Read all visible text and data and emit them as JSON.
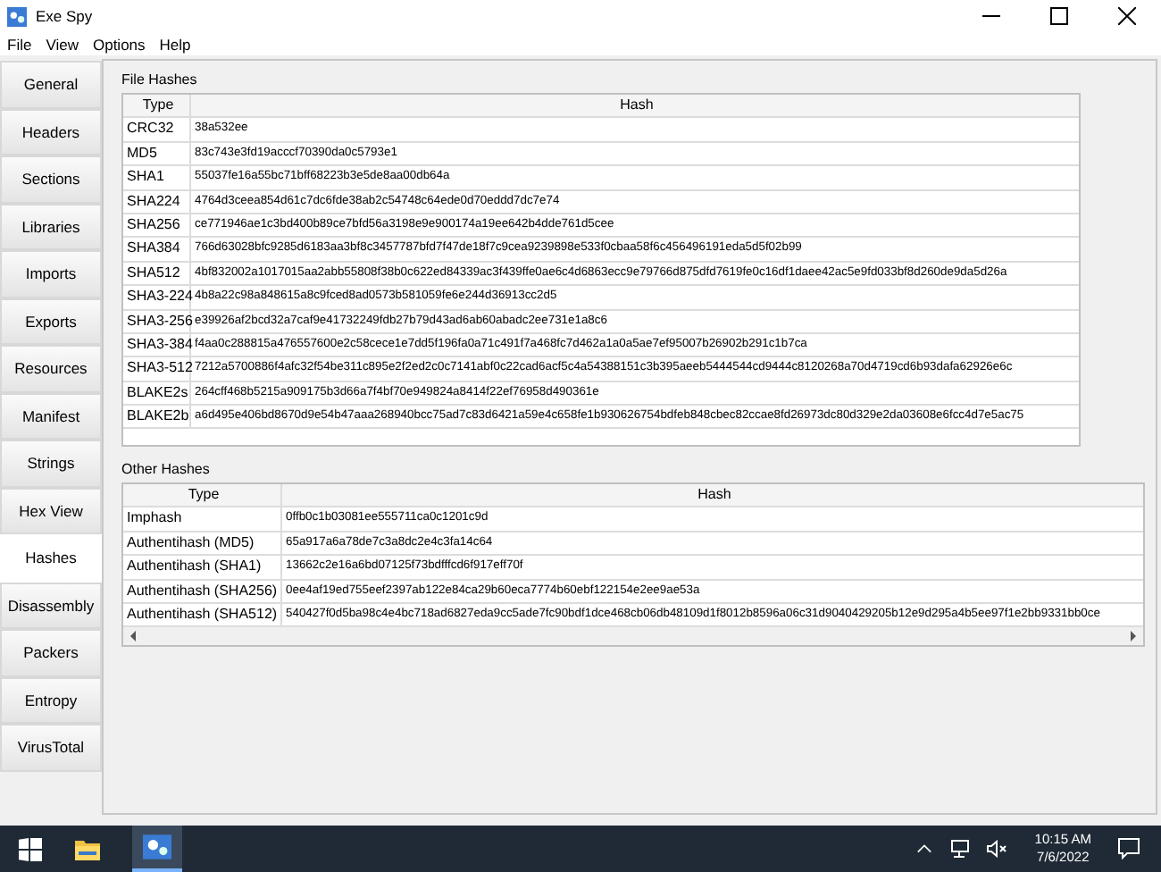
{
  "window": {
    "title": "Exe Spy"
  },
  "menu": [
    "File",
    "View",
    "Options",
    "Help"
  ],
  "sidebar": {
    "items": [
      {
        "label": "General",
        "selected": false
      },
      {
        "label": "Headers",
        "selected": false
      },
      {
        "label": "Sections",
        "selected": false
      },
      {
        "label": "Libraries",
        "selected": false
      },
      {
        "label": "Imports",
        "selected": false
      },
      {
        "label": "Exports",
        "selected": false
      },
      {
        "label": "Resources",
        "selected": false
      },
      {
        "label": "Manifest",
        "selected": false
      },
      {
        "label": "Strings",
        "selected": false
      },
      {
        "label": "Hex View",
        "selected": false
      },
      {
        "label": "Hashes",
        "selected": true
      },
      {
        "label": "Disassembly",
        "selected": false
      },
      {
        "label": "Packers",
        "selected": false
      },
      {
        "label": "Entropy",
        "selected": false
      },
      {
        "label": "VirusTotal",
        "selected": false
      }
    ]
  },
  "file_hashes": {
    "title": "File Hashes",
    "columns": [
      "Type",
      "Hash"
    ],
    "rows": [
      [
        "CRC32",
        "38a532ee"
      ],
      [
        "MD5",
        "83c743e3fd19acccf70390da0c5793e1"
      ],
      [
        "SHA1",
        "55037fe16a55bc71bff68223b3e5de8aa00db64a"
      ],
      [
        "SHA224",
        "4764d3ceea854d61c7dc6fde38ab2c54748c64ede0d70eddd7dc7e74"
      ],
      [
        "SHA256",
        "ce771946ae1c3bd400b89ce7bfd56a3198e9e900174a19ee642b4dde761d5cee"
      ],
      [
        "SHA384",
        "766d63028bfc9285d6183aa3bf8c3457787bfd7f47de18f7c9cea9239898e533f0cbaa58f6c456496191eda5d5f02b99"
      ],
      [
        "SHA512",
        "4bf832002a1017015aa2abb55808f38b0c622ed84339ac3f439ffe0ae6c4d6863ecc9e79766d875dfd7619fe0c16df1daee42ac5e9fd033bf8d260de9da5d26a"
      ],
      [
        "SHA3-224",
        "4b8a22c98a848615a8c9fced8ad0573b581059fe6e244d36913cc2d5"
      ],
      [
        "SHA3-256",
        "e39926af2bcd32a7caf9e41732249fdb27b79d43ad6ab60abadc2ee731e1a8c6"
      ],
      [
        "SHA3-384",
        "f4aa0c288815a476557600e2c58cece1e7dd5f196fa0a71c491f7a468fc7d462a1a0a5ae7ef95007b26902b291c1b7ca"
      ],
      [
        "SHA3-512",
        "7212a5700886f4afc32f54be311c895e2f2ed2c0c7141abf0c22cad6acf5c4a54388151c3b395aeeb5444544cd9444c8120268a70d4719cd6b93dafa62926e6c"
      ],
      [
        "BLAKE2s",
        "264cff468b5215a909175b3d66a7f4bf70e949824a8414f22ef76958d490361e"
      ],
      [
        "BLAKE2b",
        "a6d495e406bd8670d9e54b47aaa268940bcc75ad7c83d6421a59e4c658fe1b930626754bdfeb848cbec82ccae8fd26973dc80d329e2da03608e6fcc4d7e5ac75"
      ]
    ]
  },
  "other_hashes": {
    "title": "Other Hashes",
    "columns": [
      "Type",
      "Hash"
    ],
    "rows": [
      [
        "Imphash",
        "0ffb0c1b03081ee555711ca0c1201c9d"
      ],
      [
        "Authentihash (MD5)",
        "65a917a6a78de7c3a8dc2e4c3fa14c64"
      ],
      [
        "Authentihash (SHA1)",
        "13662c2e16a6bd07125f73bdfffcd6f917eff70f"
      ],
      [
        "Authentihash (SHA256)",
        "0ee4af19ed755eef2397ab122e84ca29b60eca7774b60ebf122154e2ee9ae53a"
      ],
      [
        "Authentihash (SHA512)",
        "540427f0d5ba98c4e4bc718ad6827eda9cc5ade7fc90bdf1dce468cb06db48109d1f8012b8596a06c31d9040429205b12e9d295a4b5ee97f1e2bb9331bb0ce"
      ]
    ]
  },
  "taskbar": {
    "time": "10:15 AM",
    "date": "7/6/2022"
  }
}
